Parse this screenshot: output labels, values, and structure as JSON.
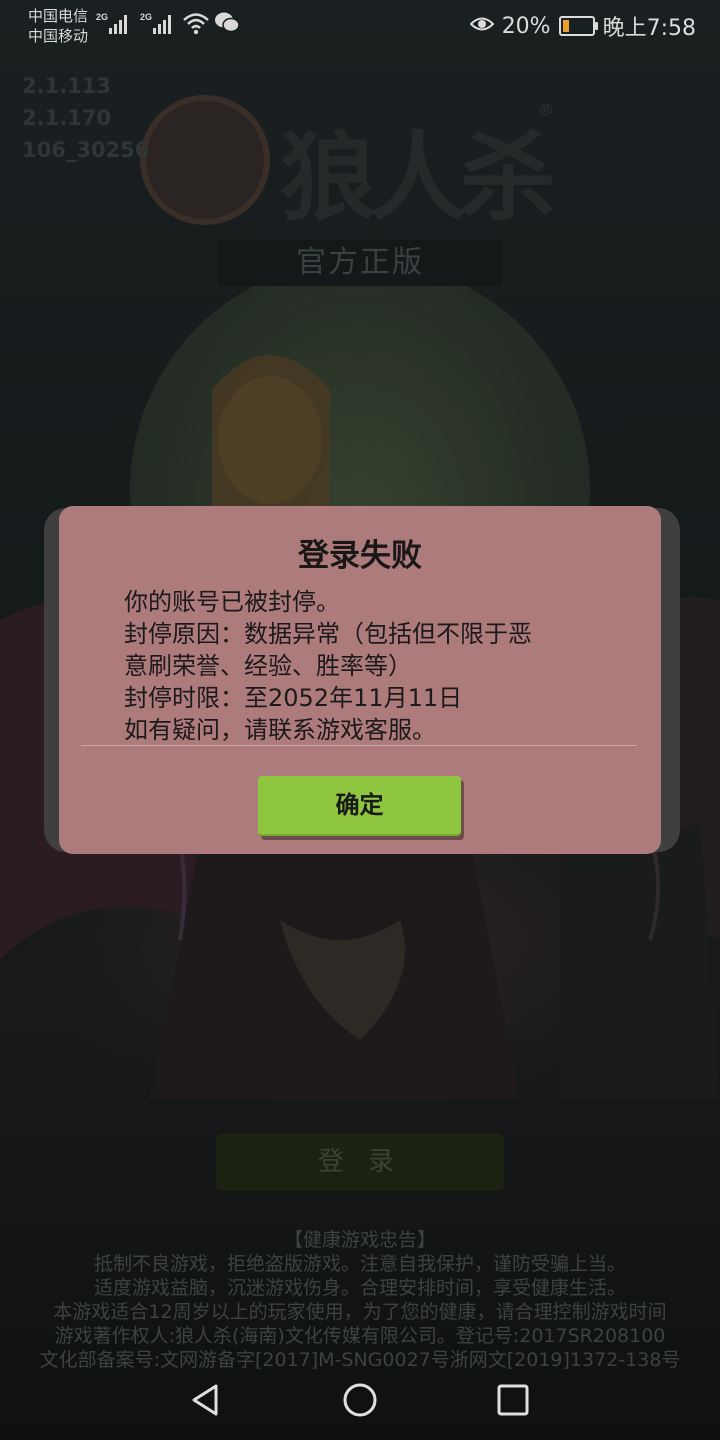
{
  "status_bar": {
    "carrier_1": "中国电信",
    "carrier_2": "中国移动",
    "network_1": "2G",
    "network_2": "2G",
    "battery_percent": "20%",
    "battery_level": 0.2,
    "time": "晚上7:58",
    "icons": [
      "signal-icon",
      "wifi-icon",
      "wechat-icon",
      "eye-icon",
      "battery-icon"
    ]
  },
  "versions": [
    "2.1.113",
    "2.1.170",
    "106_30256"
  ],
  "logo": {
    "title": "狼人杀",
    "registered": "®",
    "subtitle": "官方正版"
  },
  "dialog": {
    "title": "登录失败",
    "lines": [
      "你的账号已被封停。",
      "封停原因：数据异常（包括但不限于恶",
      "意刷荣誉、经验、胜率等）",
      "封停时限：至2052年11月11日",
      "如有疑问，请联系游戏客服。"
    ],
    "confirm_label": "确定",
    "accent": "#8ec63f",
    "background": "#ad7b7c"
  },
  "login_label": "登 录",
  "notice": {
    "title": "【健康游戏忠告】",
    "lines": [
      "抵制不良游戏，拒绝盗版游戏。注意自我保护，谨防受骗上当。",
      "适度游戏益脑，沉迷游戏伤身。合理安排时间，享受健康生活。",
      "本游戏适合12周岁以上的玩家使用，为了您的健康，请合理控制游戏时间",
      "游戏著作权人:狼人杀(海南)文化传媒有限公司。登记号:2017SR208100",
      "文化部备案号:文网游备字[2017]M-SNG0027号浙网文[2019]1372-138号"
    ]
  },
  "nav": {
    "icons": [
      "back-icon",
      "home-icon",
      "recents-icon"
    ]
  }
}
